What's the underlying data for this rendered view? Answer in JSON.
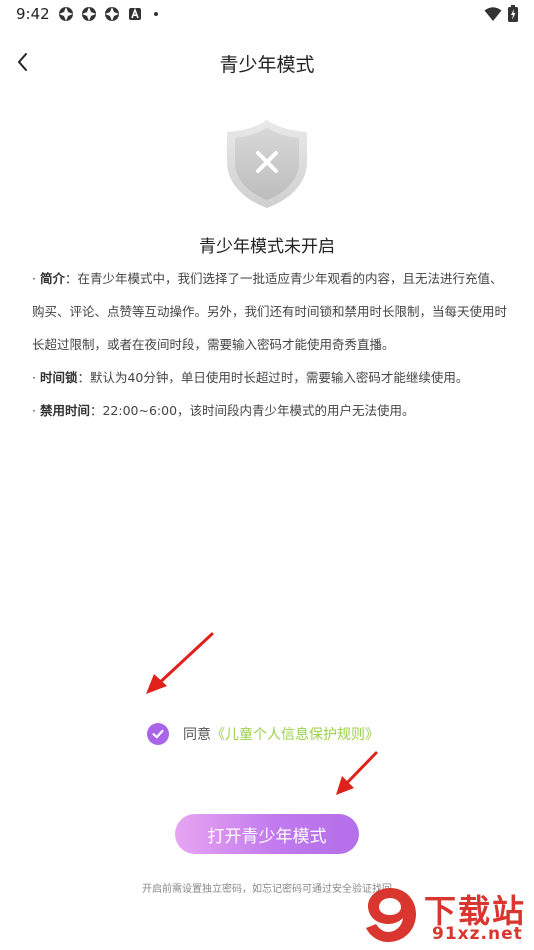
{
  "status_bar": {
    "time": "9:42",
    "icons": [
      "app-notification-icon",
      "app-notification-icon",
      "app-notification-icon",
      "a-letter-icon",
      "more-dot-icon"
    ],
    "right_icons": [
      "wifi-icon",
      "battery-icon"
    ]
  },
  "header": {
    "title": "青少年模式",
    "back_icon": "chevron-left-icon"
  },
  "hero": {
    "icon": "shield-x-icon",
    "status": "青少年模式未开启"
  },
  "description": {
    "intro_label": "简介",
    "intro_text": "：在青少年模式中，我们选择了一批适应青少年观看的内容，且无法进行充值、购买、评论、点赞等互动操作。另外，我们还有时间锁和禁用时长限制，当每天使用时长超过限制，或者在夜间时段，需要输入密码才能使用奇秀直播。",
    "timelock_label": "时间锁",
    "timelock_text": "：默认为40分钟，单日使用时长超过时，需要输入密码才能继续使用。",
    "ban_label": "禁用时间",
    "ban_text": "：22:00~6:00，该时间段内青少年模式的用户无法使用。"
  },
  "agreement": {
    "checked": true,
    "prefix": "同意",
    "link": "《儿童个人信息保护规则》"
  },
  "button": {
    "label": "打开青少年模式"
  },
  "footnote": "开启前需设置独立密码，如忘记密码可通过安全验证找回",
  "watermark": {
    "main": "下载站",
    "sub": "91xz.net"
  },
  "colors": {
    "accent": "#a964e8",
    "link": "#9bd24a",
    "arrow": "#e0201a",
    "watermark": "#d8362e"
  }
}
